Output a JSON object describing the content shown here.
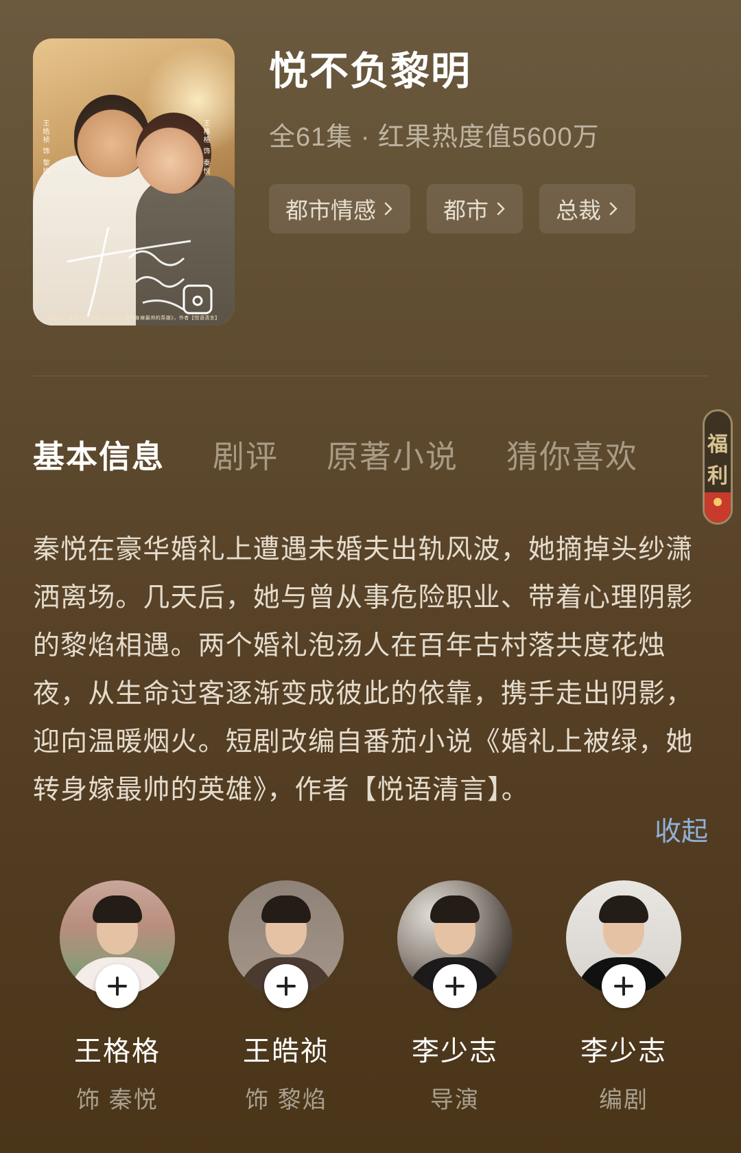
{
  "show": {
    "title": "悦不负黎明",
    "meta": "全61集 · 红果热度值5600万",
    "tags": [
      "都市情感",
      "都市",
      "总裁"
    ]
  },
  "poster": {
    "logo_text": "悦不负黎明",
    "left_credit": "王皓祯 饰 黎焰",
    "right_credit": "王格格 饰 秦悦",
    "caption": "改编自：番茄小说《婚礼上被绿，她转身嫁最帅的英雄》，作者【悦语清言】"
  },
  "tabs": [
    "基本信息",
    "剧评",
    "原著小说",
    "猜你喜欢"
  ],
  "active_tab": "基本信息",
  "welfare": {
    "label": "福利"
  },
  "description": "秦悦在豪华婚礼上遭遇未婚夫出轨风波，她摘掉头纱潇洒离场。几天后，她与曾从事危险职业、带着心理阴影的黎焰相遇。两个婚礼泡汤人在百年古村落共度花烛夜，从生命过客逐渐变成彼此的依靠，携手走出阴影，迎向温暖烟火。短剧改编自番茄小说《婚礼上被绿，她转身嫁最帅的英雄》，作者【悦语清言】。",
  "collapse_label": "收起",
  "cast": [
    {
      "name": "王格格",
      "role": "饰 秦悦"
    },
    {
      "name": "王皓祯",
      "role": "饰 黎焰"
    },
    {
      "name": "李少志",
      "role": "导演"
    },
    {
      "name": "李少志",
      "role": "编剧"
    }
  ],
  "colors": {
    "link": "#8fb2d9",
    "background": "#5f4c30",
    "welfare_accent": "#c83a2b"
  }
}
